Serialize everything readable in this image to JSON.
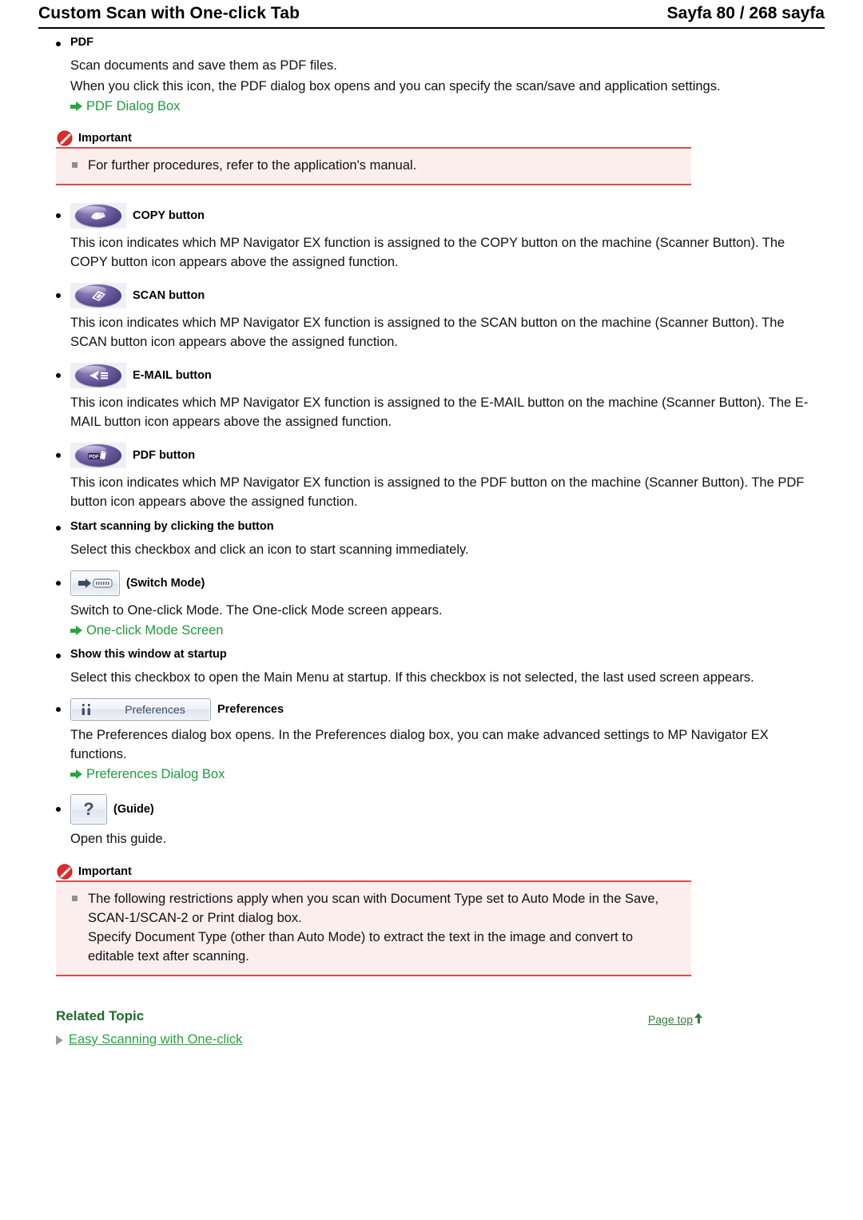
{
  "header": {
    "title": "Custom Scan with One-click Tab",
    "page_indicator": "Sayfa 80 / 268 sayfa"
  },
  "colors": {
    "link_green": "#2aa541",
    "heading_green": "#1f6b2e",
    "important_border": "#e04a4a",
    "important_bg": "#fdeeee",
    "icon_purple": "#4b3f7d"
  },
  "sections": {
    "pdf": {
      "title": "PDF",
      "para1": "Scan documents and save them as PDF files.",
      "para2": "When you click this icon, the PDF dialog box opens and you can specify the scan/save and application settings.",
      "link": "PDF Dialog Box"
    },
    "important_top": {
      "label": "Important",
      "item1": "For further procedures, refer to the application's manual."
    },
    "copy_button": {
      "title": "COPY button",
      "para": "This icon indicates which MP Navigator EX function is assigned to the COPY button on the machine (Scanner Button). The COPY button icon appears above the assigned function.",
      "icon": "copy-scanner-icon"
    },
    "scan_button": {
      "title": "SCAN button",
      "para": "This icon indicates which MP Navigator EX function is assigned to the SCAN button on the machine (Scanner Button). The SCAN button icon appears above the assigned function.",
      "icon": "scan-scanner-icon"
    },
    "email_button": {
      "title": "E-MAIL button",
      "para": "This icon indicates which MP Navigator EX function is assigned to the E-MAIL button on the machine (Scanner Button). The E-MAIL button icon appears above the assigned function.",
      "icon": "email-scanner-icon"
    },
    "pdf_button": {
      "title": "PDF button",
      "para": "This icon indicates which MP Navigator EX function is assigned to the PDF button on the machine (Scanner Button). The PDF button icon appears above the assigned function.",
      "icon": "pdf-scanner-icon",
      "icon_text": "PDF"
    },
    "start_scanning": {
      "title": "Start scanning by clicking the button",
      "para": "Select this checkbox and click an icon to start scanning immediately."
    },
    "switch_mode": {
      "title": "(Switch Mode)",
      "para": "Switch to One-click Mode. The One-click Mode screen appears.",
      "link": "One-click Mode Screen",
      "icon": "switch-mode-icon"
    },
    "show_window": {
      "title": "Show this window at startup",
      "para": "Select this checkbox to open the Main Menu at startup. If this checkbox is not selected, the last used screen appears."
    },
    "preferences": {
      "button_label": "Preferences",
      "title": "Preferences",
      "para": "The Preferences dialog box opens. In the Preferences dialog box, you can make advanced settings to MP Navigator EX functions.",
      "link": "Preferences Dialog Box"
    },
    "guide": {
      "title": "(Guide)",
      "para": "Open this guide.",
      "button_glyph": "?"
    },
    "important_bottom": {
      "label": "Important",
      "item1_line1": "The following restrictions apply when you scan with Document Type set to Auto Mode in the Save, SCAN-1/SCAN-2 or Print dialog box.",
      "item1_line2": "Specify Document Type (other than Auto Mode) to extract the text in the image and convert to editable text after scanning."
    },
    "related": {
      "heading": "Related Topic",
      "link": "Easy Scanning with One-click"
    },
    "footer": {
      "page_top": "Page top"
    }
  }
}
